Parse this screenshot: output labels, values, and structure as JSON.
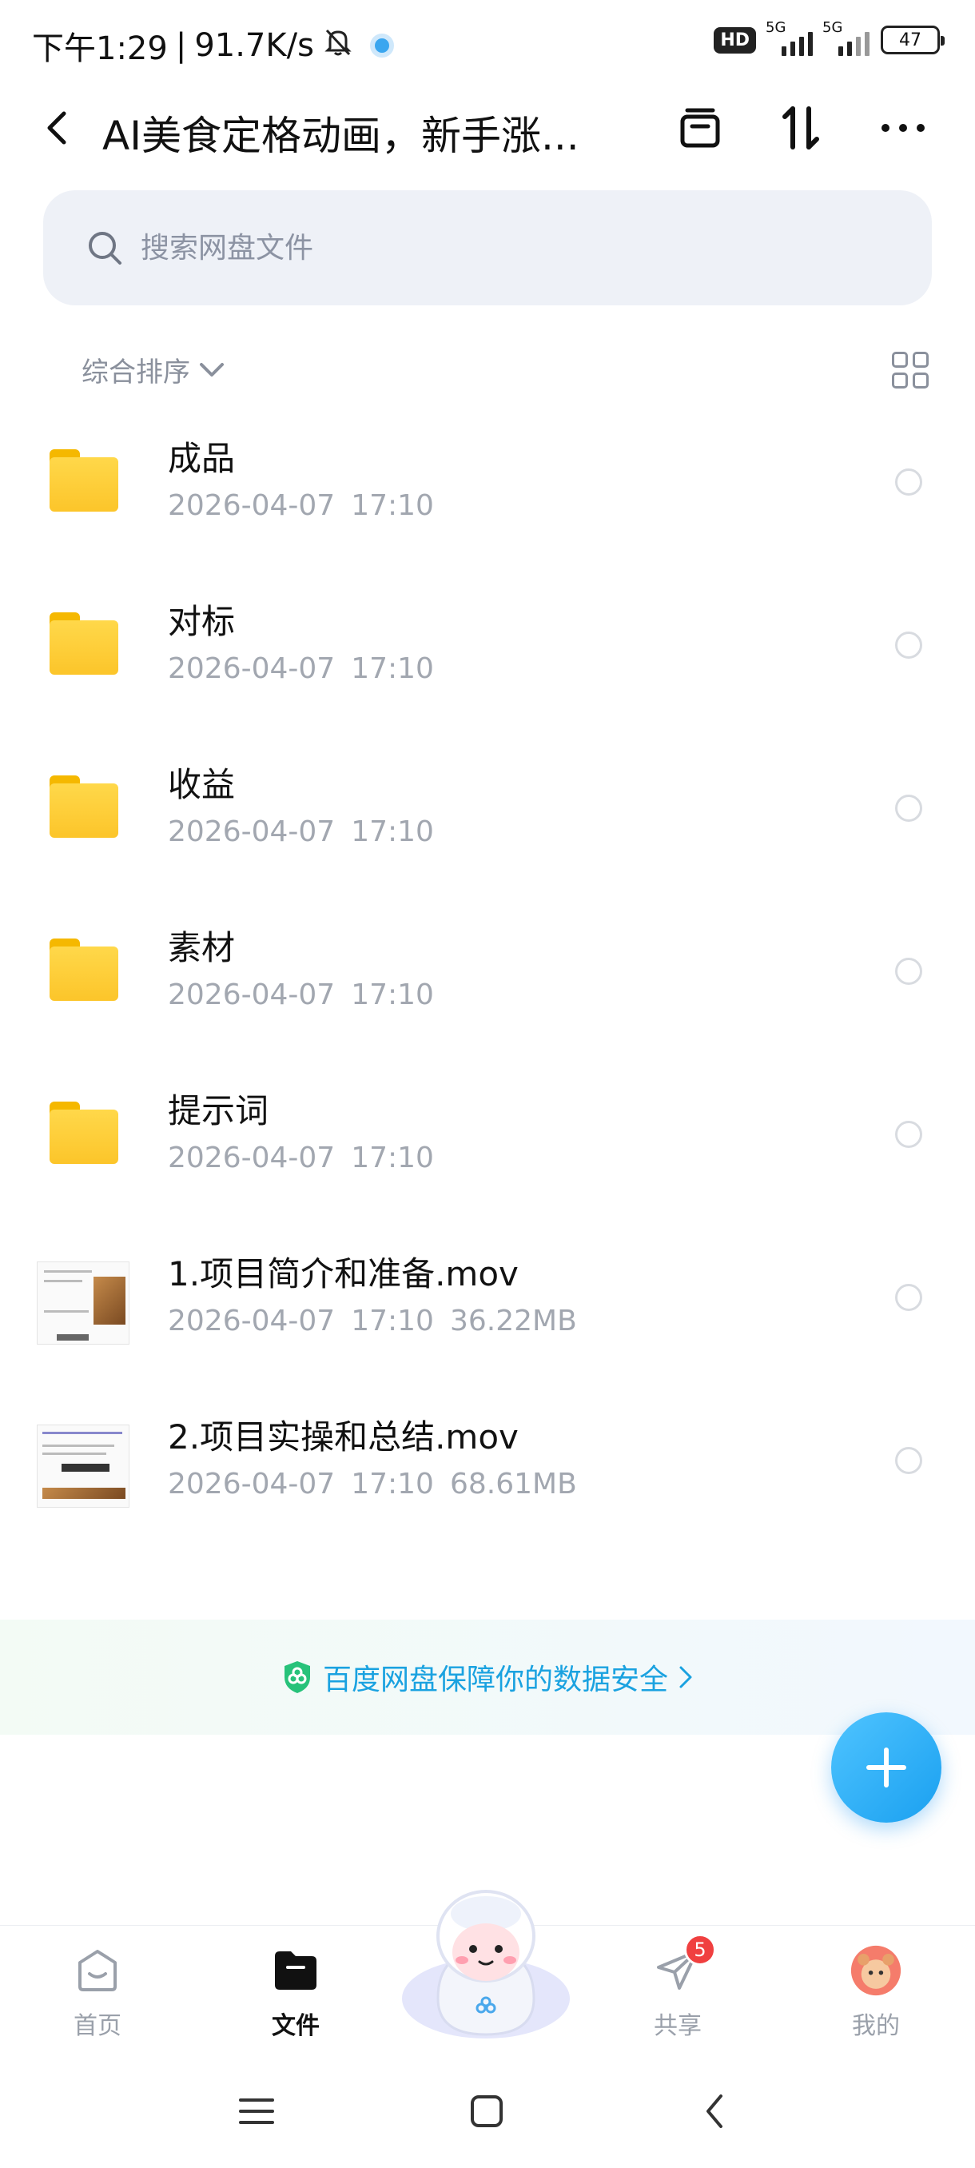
{
  "status_bar": {
    "time": "下午1:29",
    "net_speed": "91.7K/s",
    "hd_label": "HD",
    "sig1_label": "5G",
    "sig2_label": "5G",
    "battery": "47"
  },
  "header": {
    "title": "AI美食定格动画，新手涨...",
    "icons": [
      "back-icon",
      "archive-icon",
      "sort-arrows-icon",
      "more-icon"
    ]
  },
  "search": {
    "placeholder": "搜索网盘文件"
  },
  "sort": {
    "label": "综合排序"
  },
  "files": [
    {
      "name": "成品",
      "date": "2026-04-07",
      "time": "17:10",
      "size": "",
      "type": "folder"
    },
    {
      "name": "对标",
      "date": "2026-04-07",
      "time": "17:10",
      "size": "",
      "type": "folder"
    },
    {
      "name": "收益",
      "date": "2026-04-07",
      "time": "17:10",
      "size": "",
      "type": "folder"
    },
    {
      "name": "素材",
      "date": "2026-04-07",
      "time": "17:10",
      "size": "",
      "type": "folder"
    },
    {
      "name": "提示词",
      "date": "2026-04-07",
      "time": "17:10",
      "size": "",
      "type": "folder"
    },
    {
      "name": "1.项目简介和准备.mov",
      "date": "2026-04-07",
      "time": "17:10",
      "size": "36.22MB",
      "type": "video"
    },
    {
      "name": "2.项目实操和总结.mov",
      "date": "2026-04-07",
      "time": "17:10",
      "size": "68.61MB",
      "type": "video"
    }
  ],
  "banner": {
    "text": "百度网盘保障你的数据安全"
  },
  "tabs": [
    {
      "label": "首页",
      "icon": "home-icon"
    },
    {
      "label": "文件",
      "icon": "folder-icon"
    },
    {
      "label": "共享",
      "icon": "send-icon",
      "badge": "5"
    },
    {
      "label": "我的",
      "icon": "avatar-icon"
    }
  ],
  "colors": {
    "accent": "#1aa2e0",
    "folder": "#fcc52a",
    "badge": "#f04040"
  }
}
